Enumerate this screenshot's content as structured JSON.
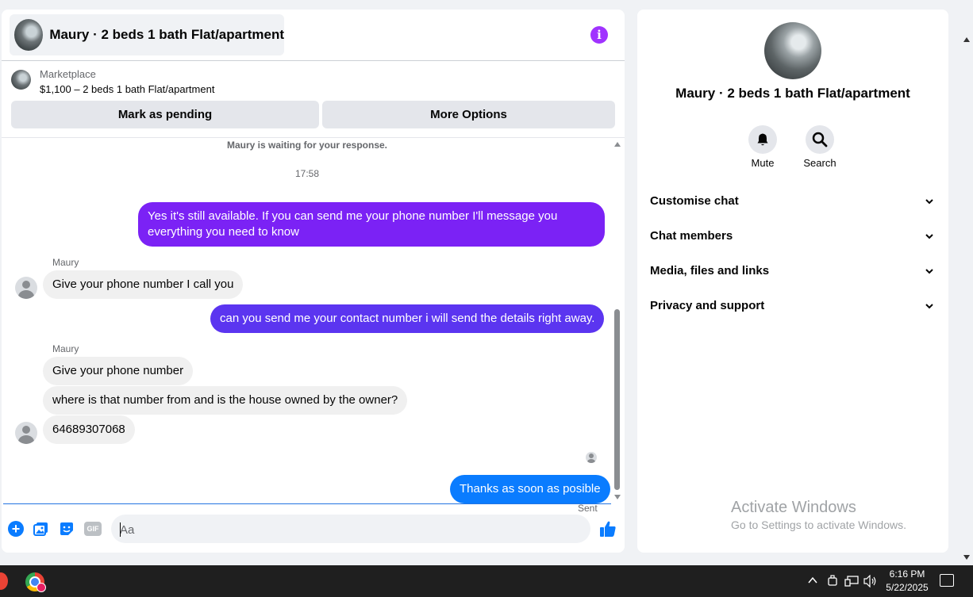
{
  "chat": {
    "header_title": "Maury · 2 beds 1 bath Flat/apartment",
    "listing": {
      "source": "Marketplace",
      "price_title": "$1,100 – 2 beds 1 bath Flat/apartment"
    },
    "buttons": {
      "mark_pending": "Mark as pending",
      "more_options": "More Options"
    },
    "status_text": "Maury is waiting for your response.",
    "timestamp": "17:58",
    "messages": [
      {
        "from": "me",
        "text": "Yes it's still available. If you can send me your phone number I'll message you everything you need to know",
        "color": "#7b22f5"
      },
      {
        "from": "Maury",
        "sender_label": "Maury",
        "text": "Give your phone number I call you"
      },
      {
        "from": "me",
        "text": "can you send me your contact number i will send the details right away.",
        "color": "#5b35f0"
      },
      {
        "from": "Maury",
        "sender_label": "Maury",
        "text": "Give your phone number"
      },
      {
        "from": "Maury",
        "text": "where is that number from and is the house owned by the owner?"
      },
      {
        "from": "Maury",
        "text": "64689307068"
      },
      {
        "from": "me",
        "text": "Thanks as soon as posible",
        "color": "#0a7cff"
      }
    ],
    "delivery_status": "Sent",
    "composer": {
      "placeholder": "Aa",
      "gif_label": "GIF"
    }
  },
  "info_panel": {
    "title": "Maury · 2 beds 1 bath Flat/apartment",
    "mute_label": "Mute",
    "search_label": "Search",
    "sections": [
      {
        "label": "Customise chat"
      },
      {
        "label": "Chat members"
      },
      {
        "label": "Media, files and links"
      },
      {
        "label": "Privacy and support"
      }
    ]
  },
  "watermark": {
    "title": "Activate Windows",
    "subtitle": "Go to Settings to activate Windows."
  },
  "taskbar": {
    "time": "6:16 PM",
    "date": "5/22/2025"
  },
  "colors": {
    "accent_purple": "#a033ff",
    "messenger_blue": "#0a7cff"
  }
}
